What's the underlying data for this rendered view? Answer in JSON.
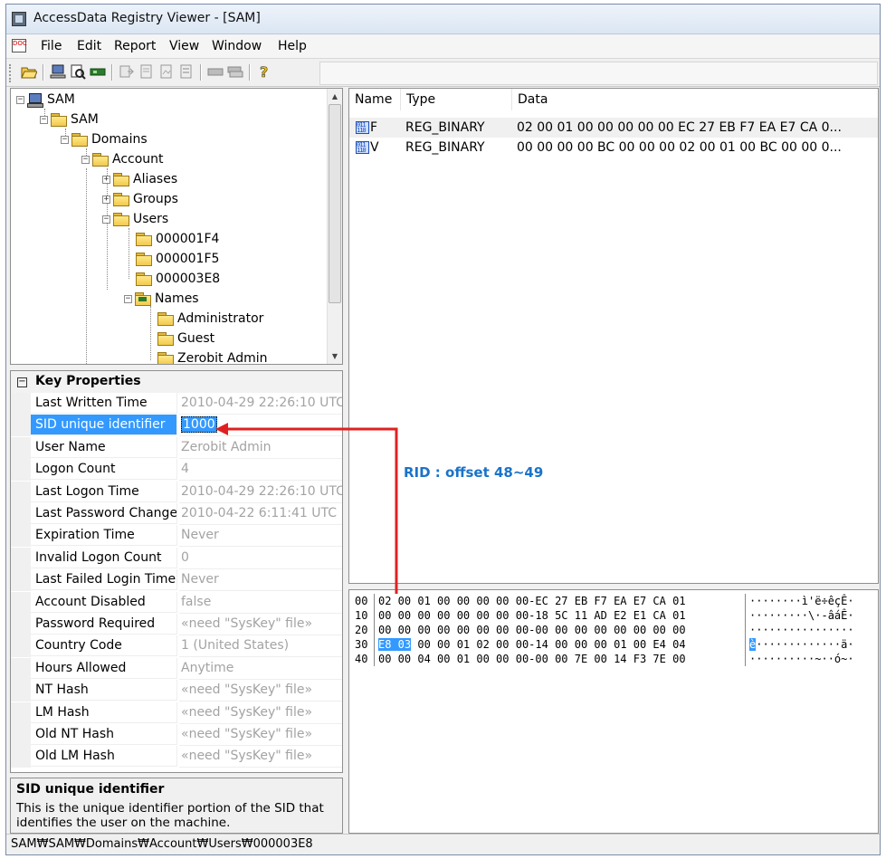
{
  "window": {
    "title": "AccessData Registry Viewer - [SAM]"
  },
  "menu": [
    "File",
    "Edit",
    "Report",
    "View",
    "Window",
    "Help"
  ],
  "tree": {
    "items": [
      {
        "label": "SAM",
        "icon": "computer-icon"
      },
      {
        "label": "SAM",
        "icon": "folder-icon"
      },
      {
        "label": "Domains",
        "icon": "folder-icon"
      },
      {
        "label": "Account",
        "icon": "folder-icon"
      },
      {
        "label": "Aliases",
        "icon": "folder-icon"
      },
      {
        "label": "Groups",
        "icon": "folder-icon"
      },
      {
        "label": "Users",
        "icon": "folder-icon"
      },
      {
        "label": "000001F4",
        "icon": "folder-icon"
      },
      {
        "label": "000001F5",
        "icon": "folder-icon"
      },
      {
        "label": "000003E8",
        "icon": "folder-icon"
      },
      {
        "label": "Names",
        "icon": "key-folder-icon"
      },
      {
        "label": "Administrator",
        "icon": "folder-icon"
      },
      {
        "label": "Guest",
        "icon": "folder-icon"
      },
      {
        "label": "Zerobit Admin",
        "icon": "folder-icon"
      }
    ]
  },
  "properties": {
    "header": "Key Properties",
    "rows": [
      {
        "name": "Last Written Time",
        "value": "2010-04-29 22:26:10 UTC"
      },
      {
        "name": "SID unique identifier",
        "value": "1000"
      },
      {
        "name": "User Name",
        "value": "Zerobit Admin"
      },
      {
        "name": "Logon Count",
        "value": "4"
      },
      {
        "name": "Last Logon Time",
        "value": "2010-04-29 22:26:10 UTC"
      },
      {
        "name": "Last Password Change",
        "value": "2010-04-22 6:11:41 UTC"
      },
      {
        "name": "Expiration Time",
        "value": "Never"
      },
      {
        "name": "Invalid Logon Count",
        "value": "0"
      },
      {
        "name": "Last Failed Login Time",
        "value": "Never"
      },
      {
        "name": "Account Disabled",
        "value": "false"
      },
      {
        "name": "Password Required",
        "value": "«need \"SysKey\" file»"
      },
      {
        "name": "Country Code",
        "value": "1 (United States)"
      },
      {
        "name": "Hours Allowed",
        "value": "Anytime"
      },
      {
        "name": "NT Hash",
        "value": "«need \"SysKey\" file»"
      },
      {
        "name": "LM Hash",
        "value": "«need \"SysKey\" file»"
      },
      {
        "name": "Old NT Hash",
        "value": "«need \"SysKey\" file»"
      },
      {
        "name": "Old LM Hash",
        "value": "«need \"SysKey\" file»"
      }
    ],
    "selected_index": 1
  },
  "description": {
    "title": "SID unique identifier",
    "text": "This is the unique identifier portion of the SID that identifies the user on the machine."
  },
  "values": {
    "columns": [
      "Name",
      "Type",
      "Data"
    ],
    "rows": [
      {
        "name": "F",
        "type": "REG_BINARY",
        "data": "02 00 01 00 00 00 00 00 EC 27 EB F7 EA E7 CA 0..."
      },
      {
        "name": "V",
        "type": "REG_BINARY",
        "data": "00 00 00 00 BC 00 00 00 02 00 01 00 BC 00 00 0..."
      }
    ]
  },
  "annotation": "RID : offset 48~49",
  "hex": {
    "rows": [
      {
        "offset": "00",
        "bytes": "02 00 01 00 00 00 00 00-EC 27 EB F7 EA E7 CA 01",
        "ascii": "········ì'ë÷êçÊ·"
      },
      {
        "offset": "10",
        "bytes": "00 00 00 00 00 00 00 00-18 5C 11 AD E2 E1 CA 01",
        "ascii": "·········\\·-âáÊ·"
      },
      {
        "offset": "20",
        "bytes": "00 00 00 00 00 00 00 00-00 00 00 00 00 00 00 00",
        "ascii": "················"
      },
      {
        "offset": "30",
        "bytes_hl": "E8 03",
        "bytes": " 00 00 01 02 00 00-14 00 00 00 01 00 E4 04",
        "ascii_hl": "è",
        "ascii": "·············ä·"
      },
      {
        "offset": "40",
        "bytes": "00 00 04 00 01 00 00 00-00 00 7E 00 14 F3 7E 00",
        "ascii": "··········~··ó~·"
      }
    ]
  },
  "statusbar": "SAM₩SAM₩Domains₩Account₩Users₩000003E8",
  "colors": {
    "selection": "#3399ff",
    "annotation_arrow": "#e02020",
    "annotation_text": "#1a73c8"
  }
}
